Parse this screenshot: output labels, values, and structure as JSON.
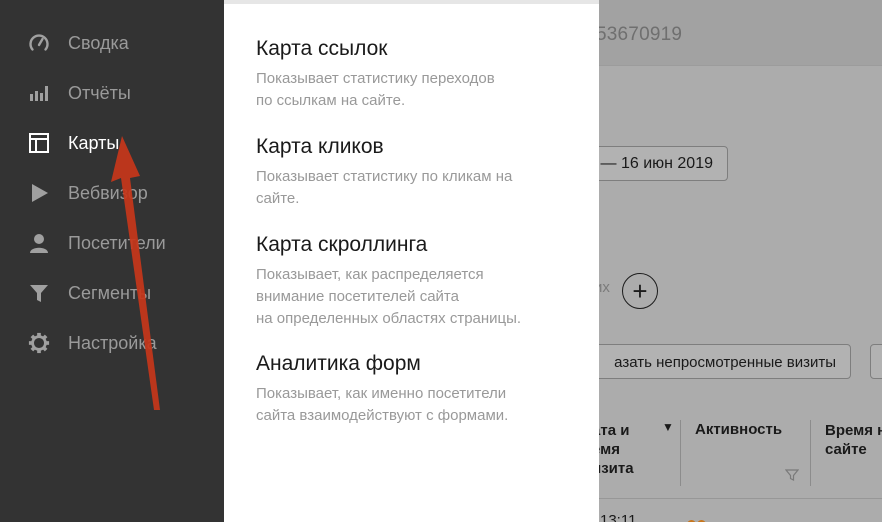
{
  "background": {
    "counter_id": "53670919",
    "date_range": "— 16 июн 2019",
    "add_segment_text": "их",
    "unviewed_visits_label": "азать непросмотренные визиты",
    "table": {
      "col_date": "ата и\nемя\nизита",
      "col_activity": "Активность",
      "col_time": "Время н\nсайте",
      "row_time": "13:11"
    }
  },
  "sidebar": {
    "items": [
      {
        "label": "Сводка",
        "icon": "dashboard-icon",
        "active": false
      },
      {
        "label": "Отчёты",
        "icon": "bar-chart-icon",
        "active": false
      },
      {
        "label": "Карты",
        "icon": "map-layout-icon",
        "active": true
      },
      {
        "label": "Вебвизор",
        "icon": "play-icon",
        "active": false
      },
      {
        "label": "Посетители",
        "icon": "person-icon",
        "active": false
      },
      {
        "label": "Сегменты",
        "icon": "filter-icon",
        "active": false
      },
      {
        "label": "Настройка",
        "icon": "gear-icon",
        "active": false
      }
    ]
  },
  "maps_menu": {
    "items": [
      {
        "title": "Карта ссылок",
        "description": "Показывает статистику переходов\nпо ссылкам на сайте."
      },
      {
        "title": "Карта кликов",
        "description": "Показывает статистику по кликам на\nсайте."
      },
      {
        "title": "Карта скроллинга",
        "description": "Показывает, как распределяется\nвнимание посетителей сайта\nна определенных областях страницы."
      },
      {
        "title": "Аналитика форм",
        "description": "Показывает, как именно посетители\nсайта взаимодействуют с формами."
      }
    ]
  },
  "colors": {
    "sidebar_bg": "#333333",
    "sidebar_text": "#9a9a9a",
    "sidebar_active_text": "#ffffff",
    "annotation_arrow": "#c7361a"
  }
}
